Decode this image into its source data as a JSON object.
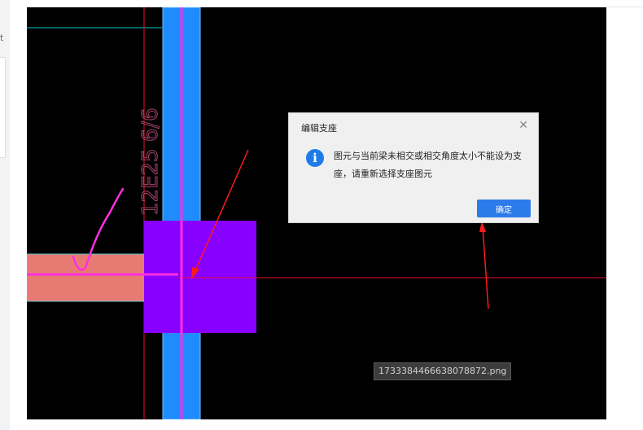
{
  "left_rail": {
    "char": "t"
  },
  "cad": {
    "vertical_label": "12E25 6/6",
    "colors": {
      "background": "#000000",
      "column": "#8800ff",
      "beam_blue": "#1e8cff",
      "beam_salmon": "#e87a74",
      "red_axis": "#e8102c",
      "magenta": "#ff2ee0",
      "cyan": "#00c8c8",
      "annotation_red": "#ff1a1a"
    }
  },
  "dialog": {
    "title": "编辑支座",
    "close_icon": "close-icon",
    "icon": "info-icon",
    "icon_glyph": "i",
    "message": "图元与当前梁未相交或相交角度太小不能设为支座，请重新选择支座图元",
    "ok_label": "确定",
    "accent_color": "#2d7bea"
  },
  "filename_label": "1733384466638078872.png"
}
